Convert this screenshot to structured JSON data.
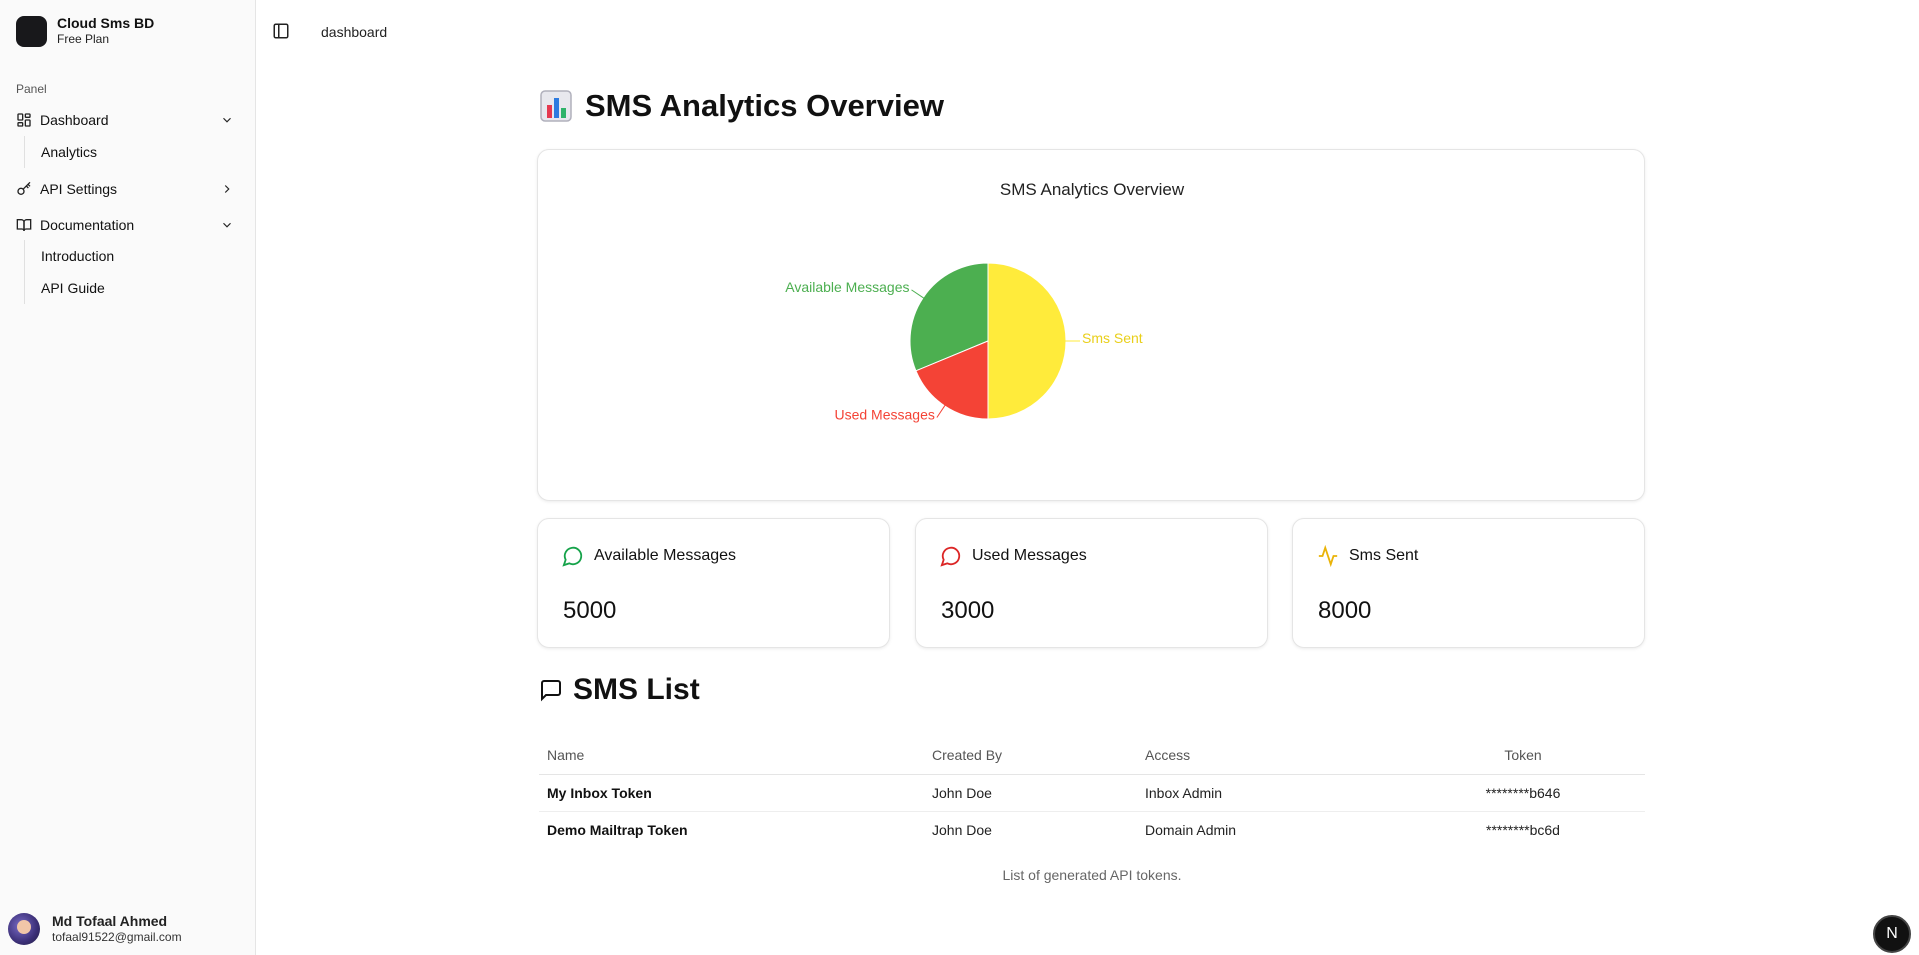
{
  "app": {
    "name": "Cloud Sms BD",
    "plan": "Free Plan"
  },
  "sidebar": {
    "section_label": "Panel",
    "items": [
      {
        "label": "Dashboard",
        "icon": "layout-grid-icon",
        "expanded": true,
        "children": [
          "Analytics"
        ]
      },
      {
        "label": "API Settings",
        "icon": "key-icon",
        "expanded": false,
        "children": []
      },
      {
        "label": "Documentation",
        "icon": "book-open-icon",
        "expanded": true,
        "children": [
          "Introduction",
          "API Guide"
        ]
      }
    ]
  },
  "user": {
    "name": "Md Tofaal Ahmed",
    "email": "tofaal91522@gmail.com"
  },
  "header": {
    "breadcrumb": "dashboard"
  },
  "main": {
    "title": "SMS Analytics Overview",
    "title_icon": "bar-chart-emoji-icon",
    "stats": [
      {
        "label": "Available Messages",
        "value": "5000",
        "icon": "message-circle-icon",
        "color": "#16a34a"
      },
      {
        "label": "Used Messages",
        "value": "3000",
        "icon": "message-circle-icon",
        "color": "#dc2626"
      },
      {
        "label": "Sms Sent",
        "value": "8000",
        "icon": "activity-icon",
        "color": "#eab308"
      }
    ],
    "list_title": "SMS List",
    "list_icon": "message-square-icon",
    "table": {
      "columns": [
        "Name",
        "Created By",
        "Access",
        "Token"
      ],
      "rows": [
        [
          "My Inbox Token",
          "John Doe",
          "Inbox Admin",
          "********b646"
        ],
        [
          "Demo Mailtrap Token",
          "John Doe",
          "Domain Admin",
          "********bc6d"
        ]
      ],
      "caption": "List of generated API tokens."
    }
  },
  "chart_data": {
    "type": "pie",
    "title": "SMS Analytics Overview",
    "categories": [
      "Available Messages",
      "Used Messages",
      "Sms Sent"
    ],
    "values": [
      5000,
      3000,
      8000
    ],
    "colors": [
      "#4caf50",
      "#f44336",
      "#ffeb3b"
    ],
    "start_angle_deg": -90,
    "direction": "counterclockwise"
  },
  "badge": {
    "label": "N"
  }
}
